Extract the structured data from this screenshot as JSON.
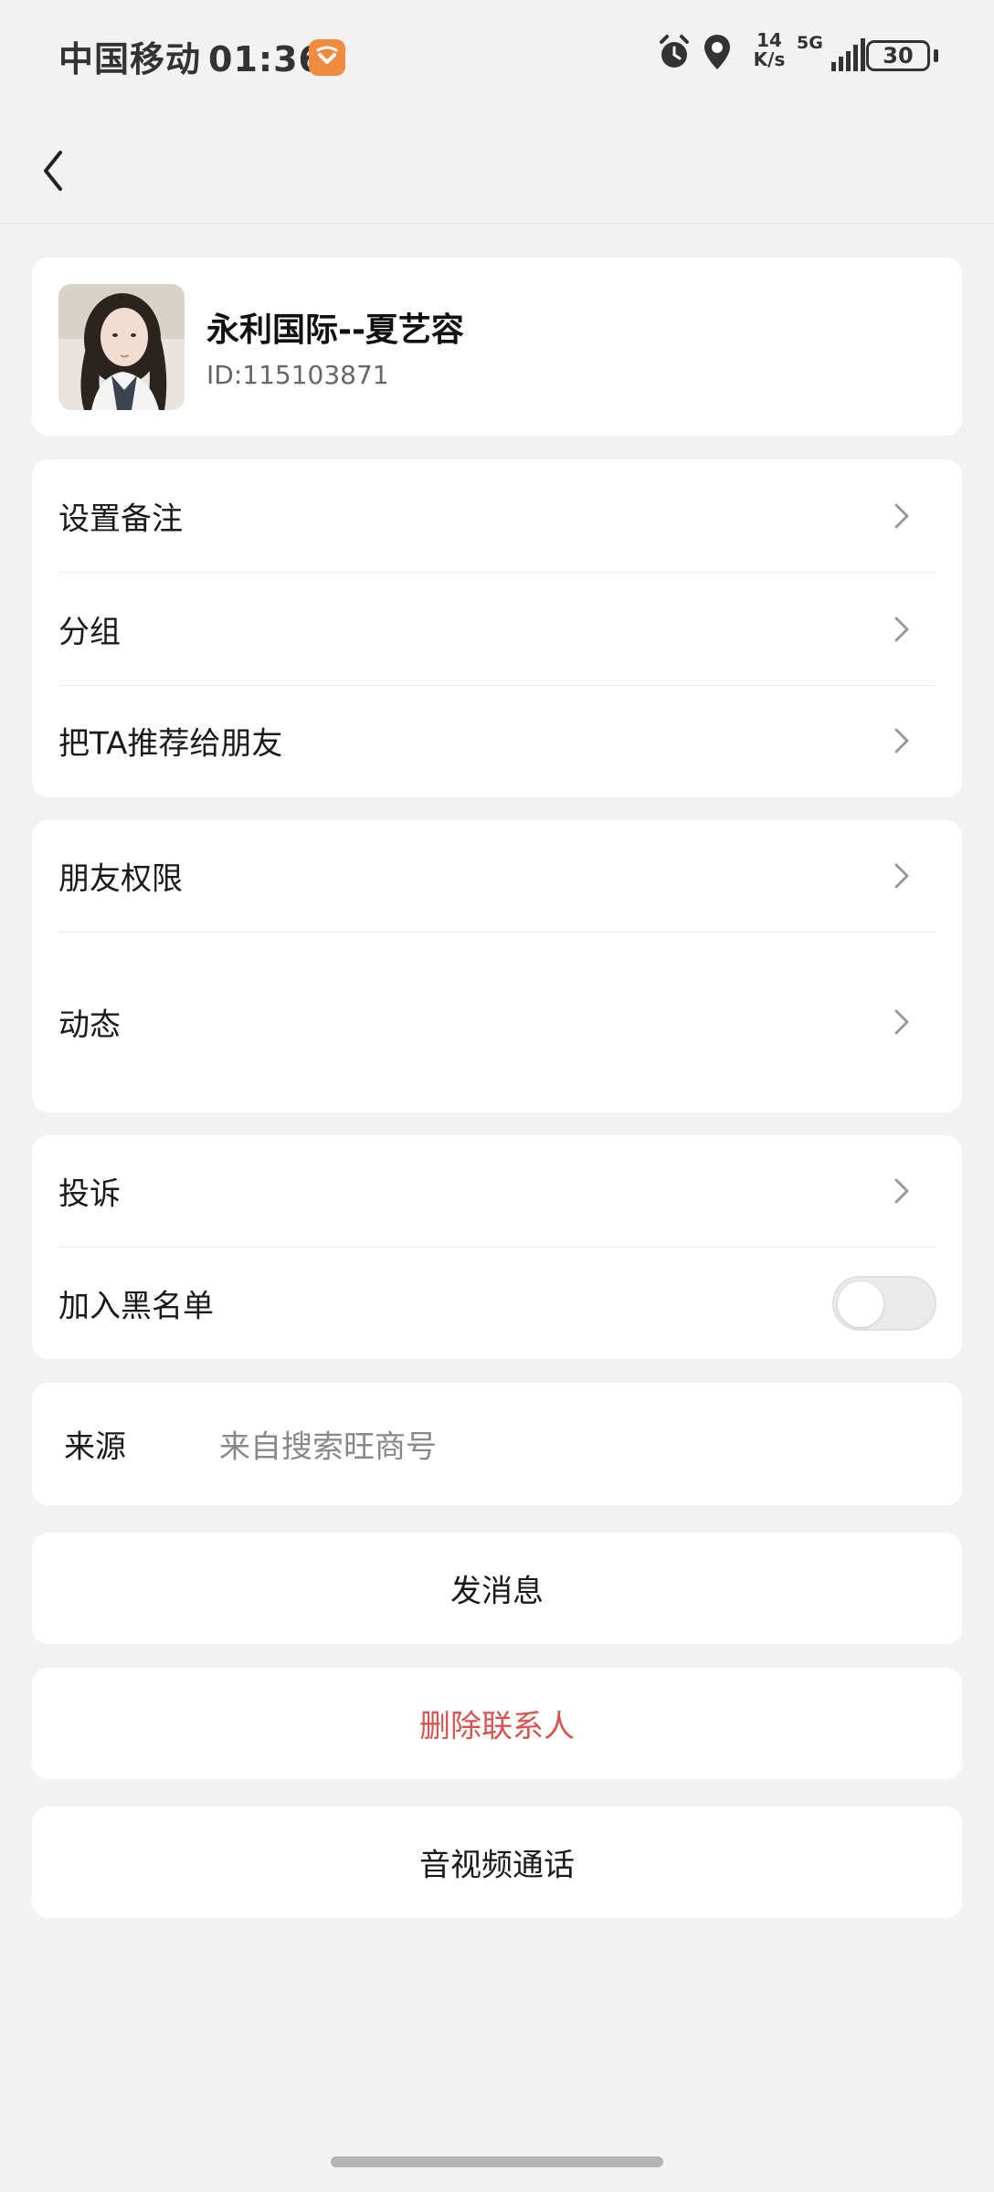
{
  "status_bar": {
    "carrier": "中国移动",
    "time": "01:36",
    "net_speed_value": "14",
    "net_speed_unit": "K/s",
    "network": "5G",
    "battery": "30",
    "icons": [
      "app-badge-icon",
      "alarm-icon",
      "location-icon",
      "signal-icon",
      "battery-icon"
    ]
  },
  "nav": {
    "back_icon": "chevron-left-icon"
  },
  "profile": {
    "name": "永利国际--夏艺容",
    "id_text": "ID:115103871"
  },
  "group1": {
    "items": [
      {
        "label": "设置备注"
      },
      {
        "label": "分组"
      },
      {
        "label": "把TA推荐给朋友"
      }
    ]
  },
  "group2": {
    "items": [
      {
        "label": "朋友权限"
      },
      {
        "label": "动态"
      }
    ]
  },
  "group3": {
    "complaint_label": "投诉",
    "blacklist_label": "加入黑名单",
    "blacklist_enabled": false
  },
  "source": {
    "label": "来源",
    "value": "来自搜索旺商号"
  },
  "actions": {
    "send_message": "发消息",
    "delete_contact": "删除联系人",
    "av_call": "音视频通话"
  },
  "colors": {
    "background": "#f2f2f2",
    "card": "#ffffff",
    "danger": "#d9534f",
    "badge": "#f08a3e"
  }
}
